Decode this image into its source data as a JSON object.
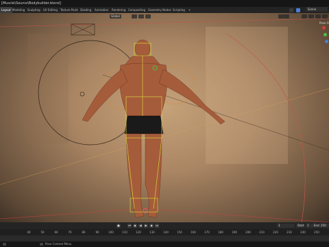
{
  "window": {
    "title": "[Muscle\\Source\\Bodybuilder.blend]"
  },
  "workspace_tabs": [
    "Layout",
    "Modeling",
    "Sculpting",
    "UV Editing",
    "Texture Paint",
    "Shading",
    "Animation",
    "Rendering",
    "Compositing",
    "Geometry Nodes",
    "Scripting",
    "+"
  ],
  "scene": {
    "label": "Scene"
  },
  "viewport_header": {
    "orientation": "Global",
    "side_label": "Pose O"
  },
  "timeline": {
    "current_frame": "1",
    "start_label": "Start",
    "start_value": "1",
    "end_label": "End",
    "end_value": "250"
  },
  "ruler_ticks": [
    "40",
    "50",
    "60",
    "70",
    "80",
    "90",
    "100",
    "110",
    "120",
    "130",
    "140",
    "150",
    "160",
    "170",
    "180",
    "190",
    "200",
    "210",
    "220",
    "230",
    "240",
    "250"
  ],
  "statusbar": {
    "text": "Pose Context Menu"
  },
  "colors": {
    "accent_blue": "#4a7fd0",
    "axis_red": "#c0574a",
    "bone_yellow": "#d9d23a",
    "skin": "#a55c3a"
  },
  "icons": [
    "select-icon",
    "cursor-icon",
    "play-icon",
    "jump-start-icon",
    "jump-end-icon",
    "keyframe-icon",
    "camera-icon",
    "light-icon"
  ]
}
